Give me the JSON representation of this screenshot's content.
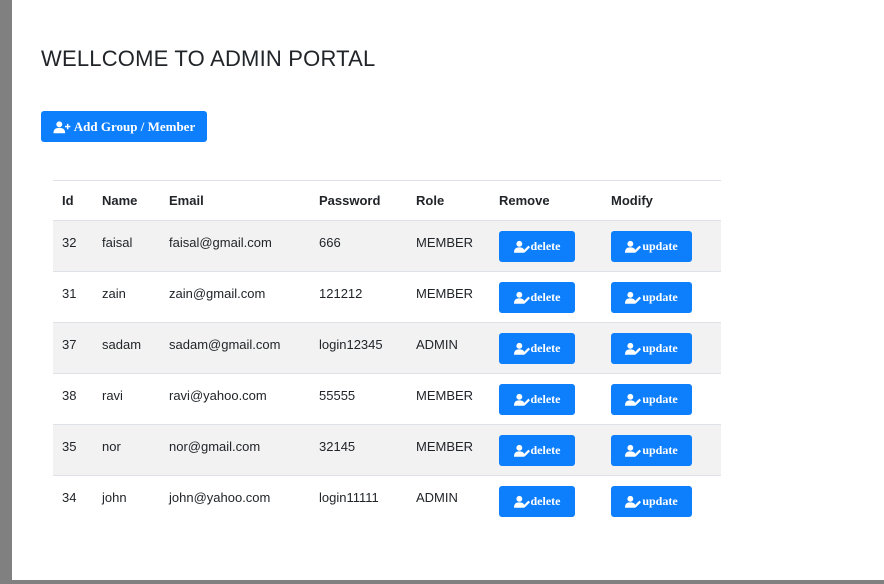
{
  "header": {
    "title": "WELLCOME TO ADMIN PORTAL"
  },
  "toolbar": {
    "add_label": "Add Group / Member",
    "add_icon": "user-plus-icon"
  },
  "table": {
    "columns": [
      "Id",
      "Name",
      "Email",
      "Password",
      "Role",
      "Remove",
      "Modify"
    ],
    "delete_label": "delete",
    "update_label": "update",
    "rows": [
      {
        "id": "32",
        "name": "faisal",
        "email": "faisal@gmail.com",
        "password": "666",
        "role": "MEMBER"
      },
      {
        "id": "31",
        "name": "zain",
        "email": "zain@gmail.com",
        "password": "121212",
        "role": "MEMBER"
      },
      {
        "id": "37",
        "name": "sadam",
        "email": "sadam@gmail.com",
        "password": "login12345",
        "role": "ADMIN"
      },
      {
        "id": "38",
        "name": "ravi",
        "email": "ravi@yahoo.com",
        "password": "55555",
        "role": "MEMBER"
      },
      {
        "id": "35",
        "name": "nor",
        "email": "nor@gmail.com",
        "password": "32145",
        "role": "MEMBER"
      },
      {
        "id": "34",
        "name": "john",
        "email": "john@yahoo.com",
        "password": "login11111",
        "role": "ADMIN"
      }
    ]
  },
  "colors": {
    "primary": "#0d7efc",
    "stripe": "#f2f2f2",
    "frame": "#808080"
  }
}
